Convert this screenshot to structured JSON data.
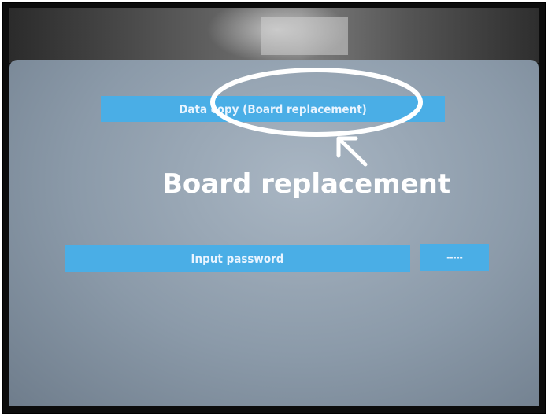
{
  "screen": {
    "data_copy_label": "Data copy (Board replacement)",
    "input_password_label": "Input password",
    "password_value": "-----"
  },
  "annotation": {
    "callout_text": "Board replacement",
    "color": "#ffffff"
  },
  "colors": {
    "menu_bar": "#4aaee6",
    "screen_background": "#8b9aa9"
  }
}
